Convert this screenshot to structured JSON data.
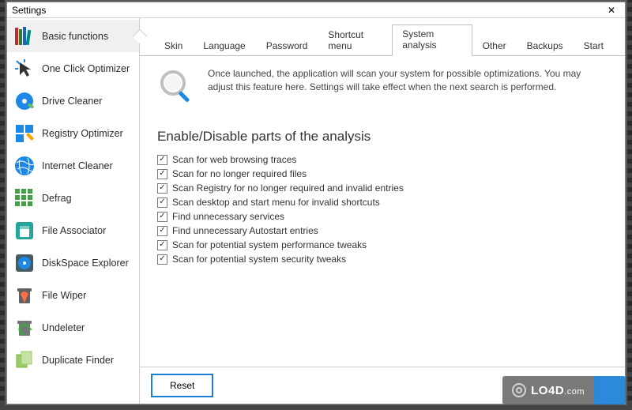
{
  "window": {
    "title": "Settings"
  },
  "sidebar": {
    "items": [
      {
        "label": "Basic functions"
      },
      {
        "label": "One Click Optimizer"
      },
      {
        "label": "Drive Cleaner"
      },
      {
        "label": "Registry Optimizer"
      },
      {
        "label": "Internet Cleaner"
      },
      {
        "label": "Defrag"
      },
      {
        "label": "File Associator"
      },
      {
        "label": "DiskSpace Explorer"
      },
      {
        "label": "File Wiper"
      },
      {
        "label": "Undeleter"
      },
      {
        "label": "Duplicate Finder"
      }
    ]
  },
  "tabs": {
    "items": [
      {
        "label": "Skin"
      },
      {
        "label": "Language"
      },
      {
        "label": "Password"
      },
      {
        "label": "Shortcut menu"
      },
      {
        "label": "System analysis"
      },
      {
        "label": "Other"
      },
      {
        "label": "Backups"
      },
      {
        "label": "Start"
      }
    ],
    "active_index": 4
  },
  "intro": {
    "text": "Once launched, the application will scan your system for possible optimizations. You may adjust this feature here. Settings will take effect when the next search is performed."
  },
  "section": {
    "title": "Enable/Disable parts of the analysis"
  },
  "options": [
    {
      "checked": true,
      "label": "Scan for web browsing traces"
    },
    {
      "checked": true,
      "label": "Scan for no longer required files"
    },
    {
      "checked": true,
      "label": "Scan Registry for no longer required and invalid entries"
    },
    {
      "checked": true,
      "label": "Scan desktop and start menu for invalid shortcuts"
    },
    {
      "checked": true,
      "label": "Find unnecessary services"
    },
    {
      "checked": true,
      "label": "Find unnecessary Autostart entries"
    },
    {
      "checked": true,
      "label": "Scan for potential system performance tweaks"
    },
    {
      "checked": true,
      "label": "Scan for potential system security tweaks"
    }
  ],
  "footer": {
    "reset_label": "Reset"
  },
  "watermark": {
    "text": "LO4D",
    "suffix": ".com"
  }
}
